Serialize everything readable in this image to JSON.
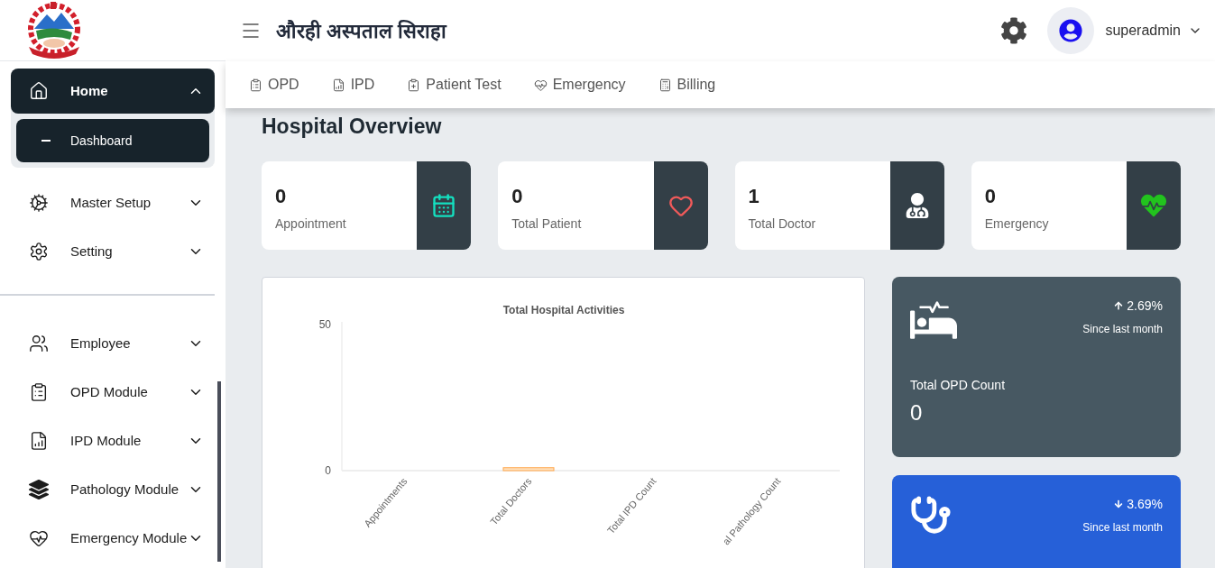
{
  "header": {
    "title": "औरही अस्पताल सिराहा",
    "user": "superadmin"
  },
  "sidebar": {
    "items": [
      {
        "label": "Home",
        "expanded": true,
        "children": [
          {
            "label": "Dashboard",
            "selected": true
          }
        ]
      },
      {
        "label": "Master Setup",
        "expanded": false
      },
      {
        "label": "Setting",
        "expanded": false
      },
      {
        "kind": "divider"
      },
      {
        "label": "Employee",
        "expanded": false
      },
      {
        "label": "OPD Module",
        "expanded": false
      },
      {
        "label": "IPD Module",
        "expanded": false
      },
      {
        "label": "Pathology Module",
        "expanded": false
      },
      {
        "label": "Emergency Module",
        "expanded": false
      }
    ]
  },
  "tabs": [
    {
      "label": "OPD"
    },
    {
      "label": "IPD"
    },
    {
      "label": "Patient Test"
    },
    {
      "label": "Emergency"
    },
    {
      "label": "Billing"
    }
  ],
  "page_title": "Hospital Overview",
  "stats": [
    {
      "value": "0",
      "label": "Appointment",
      "color": "#14e0c0"
    },
    {
      "value": "0",
      "label": "Total Patient",
      "color": "#f05a5a"
    },
    {
      "value": "1",
      "label": "Total Doctor",
      "color": "#ffffff"
    },
    {
      "value": "0",
      "label": "Emergency",
      "color": "#22c31e"
    }
  ],
  "chart": {
    "chart_data": {
      "type": "bar",
      "title": "Total Hospital Activities",
      "categories": [
        "Appointments",
        "Total Doctors",
        "Total IPD Count",
        "al Pathology Count"
      ],
      "values": [
        0,
        1,
        0,
        0
      ],
      "ylim": [
        0,
        50
      ],
      "yticks": [
        0,
        50
      ]
    }
  },
  "summary_cards": [
    {
      "kind": "rising",
      "change": "2.69%",
      "note": "Since last month",
      "label": "Total OPD Count",
      "value": "0",
      "color": "#475862"
    },
    {
      "kind": "falling",
      "change": "3.69%",
      "note": "Since last month",
      "color": "#2660d8"
    }
  ]
}
